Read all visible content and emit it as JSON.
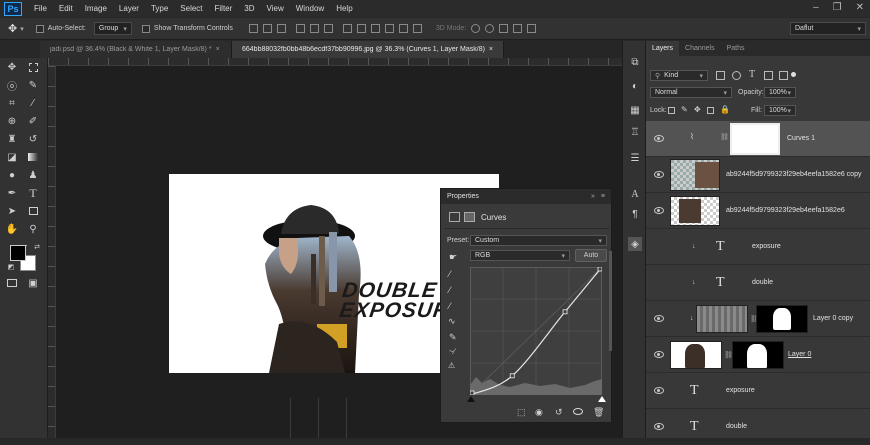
{
  "app": {
    "logo": "Ps"
  },
  "menu": [
    "File",
    "Edit",
    "Image",
    "Layer",
    "Type",
    "Select",
    "Filter",
    "3D",
    "View",
    "Window",
    "Help"
  ],
  "window_controls": [
    "–",
    "❐",
    "✕"
  ],
  "options_bar": {
    "auto_select_label": "Auto-Select:",
    "auto_select_value": "Group",
    "transform_label": "Show Transform Controls",
    "mode_3d": "3D Mode:",
    "workspace": "Daflut"
  },
  "tabs": [
    {
      "label": "jadi.psd @ 36.4% (Black & White 1, Layer Mask/8) *"
    },
    {
      "label": "664bb88032fb0bb48b6ecdf37bb90996.jpg @ 36.3% (Curves 1, Layer Mask/8) *"
    }
  ],
  "artwork": {
    "line1": "DOUBLE",
    "line2": "EXPOSURE"
  },
  "properties": {
    "title": "Properties",
    "panel_type": "Curves",
    "preset_label": "Preset:",
    "preset_value": "Custom",
    "channel_value": "RGB",
    "auto_button": "Auto",
    "curve_points": [
      [
        0,
        0
      ],
      [
        0.32,
        0.15
      ],
      [
        0.72,
        0.65
      ],
      [
        1,
        1
      ]
    ]
  },
  "layers_panel": {
    "tabs": [
      "Layers",
      "Channels",
      "Paths"
    ],
    "filter_value": "Kind",
    "blend_mode": "Normal",
    "opacity_label": "Opacity:",
    "opacity_value": "100%",
    "lock_label": "Lock:",
    "fill_label": "Fill:",
    "fill_value": "100%",
    "layers": [
      {
        "name": "Curves 1"
      },
      {
        "name": "ab9244f5d9799323f29eb4eefa1582e6 copy"
      },
      {
        "name": "ab9244f5d9799323f29eb4eefa1582e6"
      },
      {
        "name": "exposure"
      },
      {
        "name": "double"
      },
      {
        "name": "Layer 0 copy"
      },
      {
        "name": "Layer 0"
      },
      {
        "name": "exposure"
      },
      {
        "name": "double"
      }
    ]
  }
}
